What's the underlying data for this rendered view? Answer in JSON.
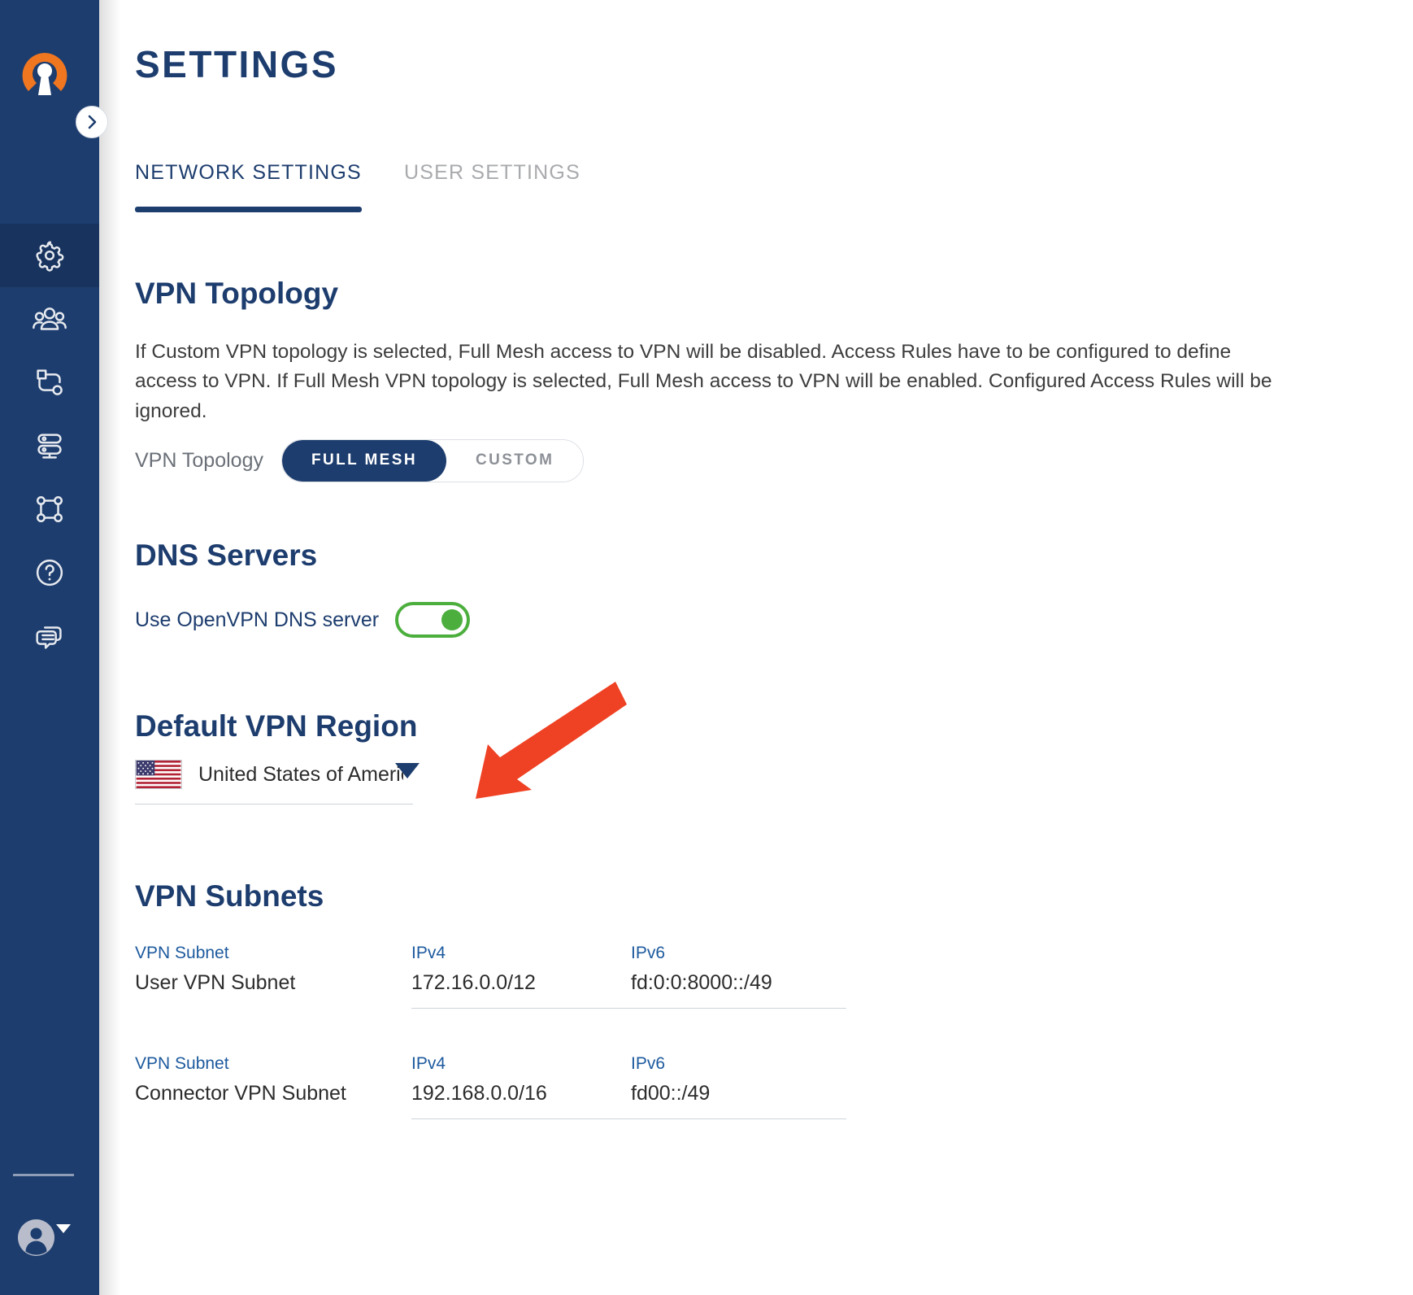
{
  "app": {
    "brand_icon": "openvpn-logo-icon",
    "sidebar_bg": "#1d3d6e",
    "accent": "#1d3d6e",
    "toggle_on_color": "#4caf3d",
    "annotation_color": "#ef4123"
  },
  "sidebar": {
    "expand_icon": "chevron-right-icon",
    "items": [
      {
        "icon": "gear-icon",
        "name": "settings",
        "active": true
      },
      {
        "icon": "users-icon",
        "name": "users",
        "active": false
      },
      {
        "icon": "connector-icon",
        "name": "connectors",
        "active": false
      },
      {
        "icon": "servers-icon",
        "name": "servers",
        "active": false
      },
      {
        "icon": "network-topology-icon",
        "name": "networks",
        "active": false
      },
      {
        "icon": "help-circle-icon",
        "name": "help",
        "active": false
      },
      {
        "icon": "chat-bubbles-icon",
        "name": "support",
        "active": false
      }
    ],
    "user": {
      "avatar_icon": "user-avatar-icon",
      "caret_icon": "caret-down-icon"
    }
  },
  "header": {
    "title": "SETTINGS"
  },
  "tabs": [
    {
      "label": "NETWORK SETTINGS",
      "active": true
    },
    {
      "label": "USER SETTINGS",
      "active": false
    }
  ],
  "sections": {
    "topology": {
      "heading": "VPN Topology",
      "description": "If Custom VPN topology is selected, Full Mesh access to VPN will be disabled. Access Rules have to be configured to define access to VPN. If Full Mesh VPN topology is selected, Full Mesh access to VPN will be enabled. Configured Access Rules will be ignored.",
      "field_label": "VPN Topology",
      "options": [
        {
          "label": "FULL MESH",
          "active": true
        },
        {
          "label": "CUSTOM",
          "active": false
        }
      ]
    },
    "dns": {
      "heading": "DNS Servers",
      "toggle_label": "Use OpenVPN DNS server",
      "toggle_state": "on"
    },
    "region": {
      "heading": "Default VPN Region",
      "flag_icon": "usa-flag-icon",
      "value": "United States of America, S",
      "caret_icon": "caret-down-icon"
    },
    "subnets": {
      "heading": "VPN Subnets",
      "columns": {
        "name": "VPN Subnet",
        "ipv4": "IPv4",
        "ipv6": "IPv6"
      },
      "rows": [
        {
          "name": "User VPN Subnet",
          "ipv4": "172.16.0.0/12",
          "ipv6": "fd:0:0:8000::/49"
        },
        {
          "name": "Connector VPN Subnet",
          "ipv4": "192.168.0.0/16",
          "ipv6": "fd00::/49"
        }
      ]
    }
  }
}
